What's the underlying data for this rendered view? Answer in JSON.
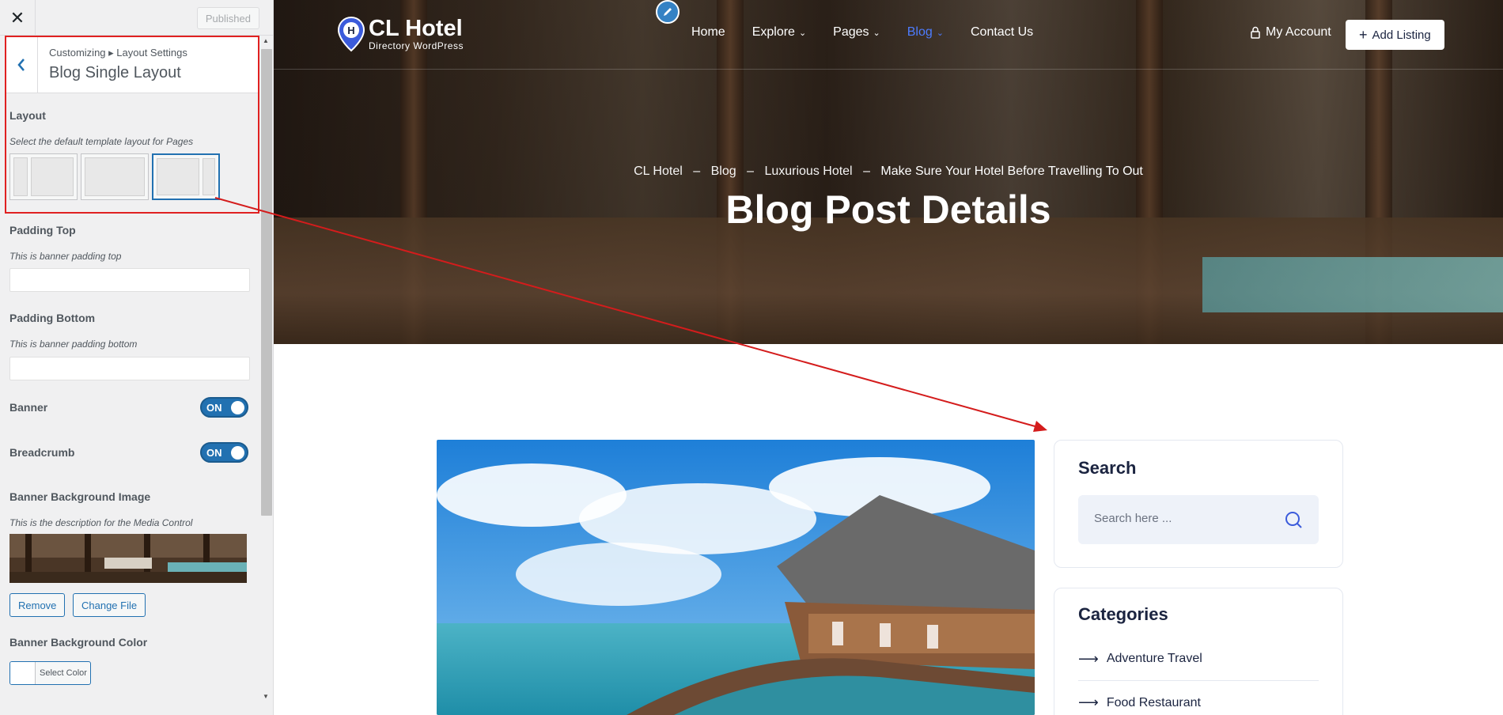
{
  "customizer": {
    "close_label": "✕",
    "publish_label": "Published",
    "back_label": "‹",
    "crumb": "Customizing ▸ Layout Settings",
    "section_title": "Blog Single Layout",
    "layout": {
      "label": "Layout",
      "description": "Select the default template layout for Pages",
      "selected_index": 2
    },
    "padding_top": {
      "label": "Padding Top",
      "description": "This is banner padding top",
      "value": ""
    },
    "padding_bottom": {
      "label": "Padding Bottom",
      "description": "This is banner padding bottom",
      "value": ""
    },
    "banner": {
      "label": "Banner",
      "state": "ON"
    },
    "breadcrumb": {
      "label": "Breadcrumb",
      "state": "ON"
    },
    "banner_bg_image": {
      "label": "Banner Background Image",
      "description": "This is the description for the Media Control",
      "remove_label": "Remove",
      "change_label": "Change File"
    },
    "banner_bg_color": {
      "label": "Banner Background Color",
      "button_label": "Select Color"
    }
  },
  "site": {
    "logo_name": "CL Hotel",
    "logo_tagline": "Directory WordPress",
    "nav": [
      {
        "label": "Home",
        "dropdown": false,
        "active": false
      },
      {
        "label": "Explore",
        "dropdown": true,
        "active": false
      },
      {
        "label": "Pages",
        "dropdown": true,
        "active": false
      },
      {
        "label": "Blog",
        "dropdown": true,
        "active": true
      },
      {
        "label": "Contact Us",
        "dropdown": false,
        "active": false
      }
    ],
    "account_label": "My Account",
    "add_listing_label": "Add Listing",
    "breadcrumb": [
      "CL Hotel",
      "Blog",
      "Luxurious Hotel",
      "Make Sure Your Hotel Before Travelling To Out"
    ],
    "breadcrumb_separator": "–",
    "hero_title": "Blog Post Details",
    "accent_color": "#4d7cff"
  },
  "sidebar": {
    "search": {
      "title": "Search",
      "placeholder": "Search here ..."
    },
    "categories": {
      "title": "Categories",
      "items": [
        "Adventure Travel",
        "Food Restaurant"
      ]
    }
  }
}
